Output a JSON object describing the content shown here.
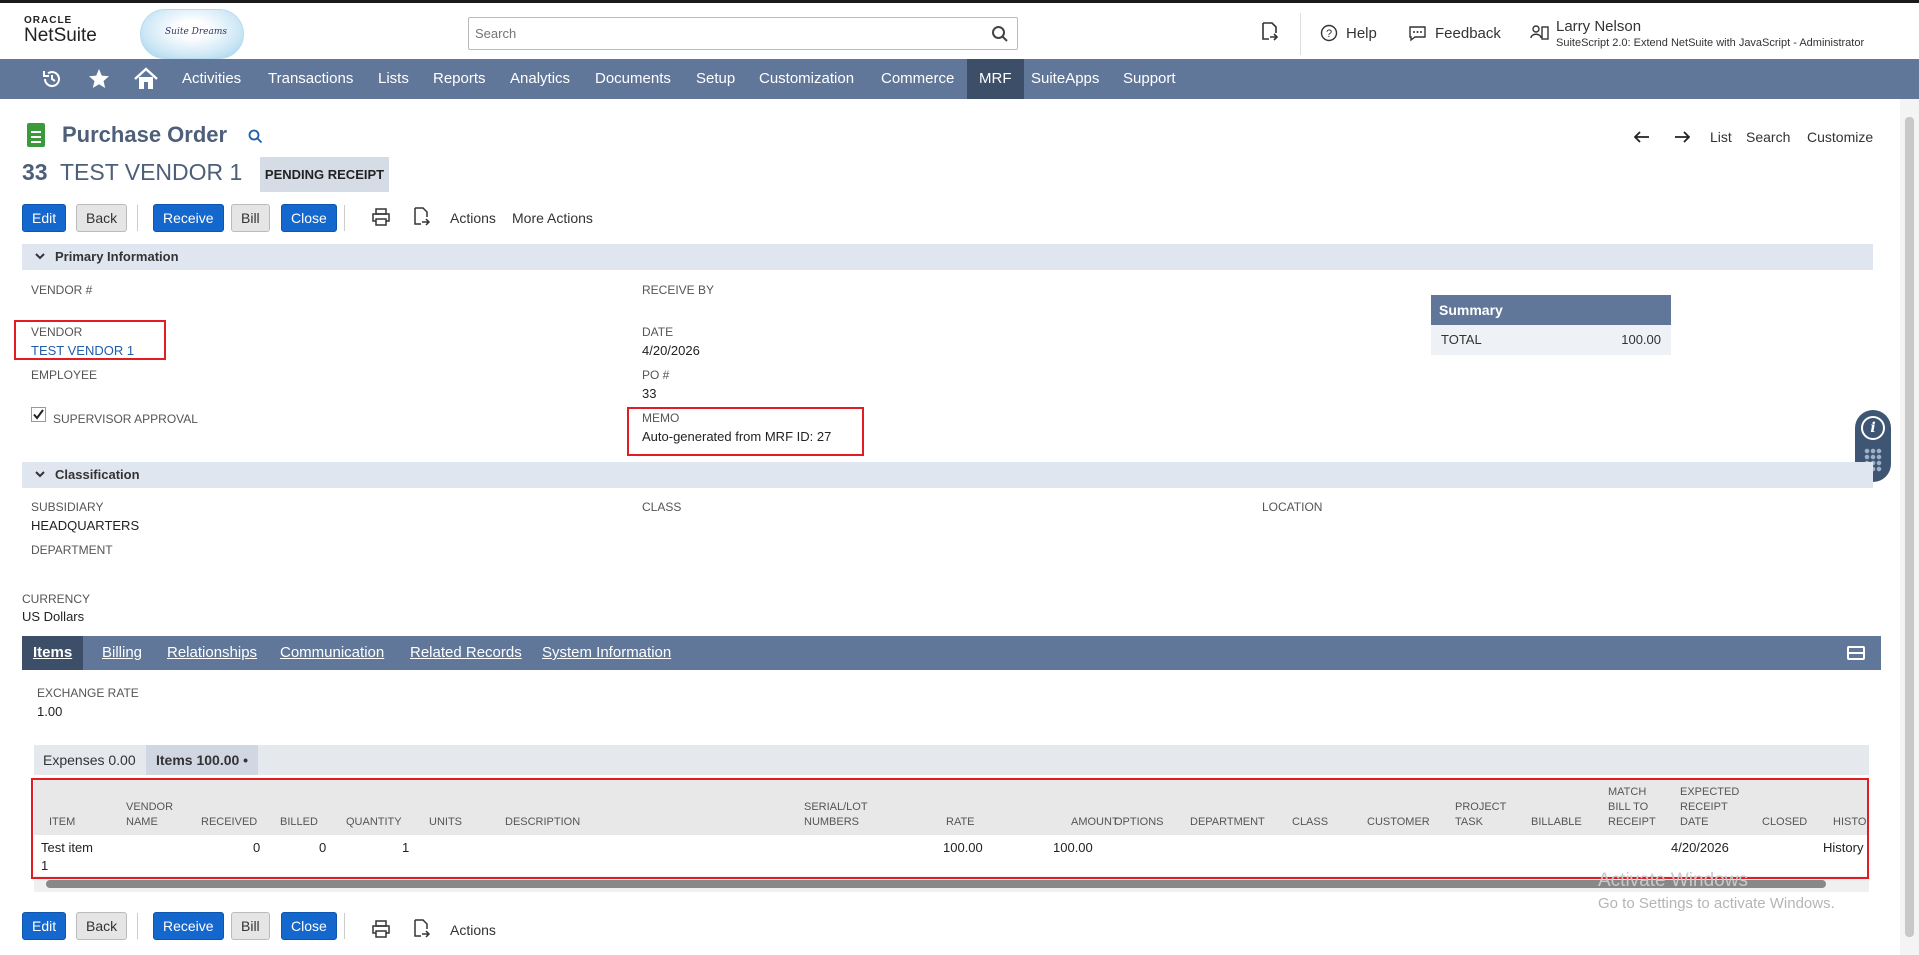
{
  "header": {
    "brand_top": "ORACLE",
    "brand_main": "NetSuite",
    "cloud_logo_text": "Suite Dreams",
    "search_placeholder": "Search",
    "help": "Help",
    "feedback": "Feedback",
    "user_name": "Larry Nelson",
    "user_role": "SuiteScript 2.0: Extend NetSuite with JavaScript - Administrator"
  },
  "nav": {
    "items": [
      "Activities",
      "Transactions",
      "Lists",
      "Reports",
      "Analytics",
      "Documents",
      "Setup",
      "Customization",
      "Commerce",
      "MRF",
      "SuiteApps",
      "Support"
    ],
    "active": "MRF"
  },
  "record": {
    "type": "Purchase Order",
    "number": "33",
    "vendor_title": "TEST VENDOR 1",
    "status": "PENDING RECEIPT",
    "top_nav": {
      "list": "List",
      "search": "Search",
      "customize": "Customize"
    }
  },
  "actions": {
    "edit": "Edit",
    "back": "Back",
    "receive": "Receive",
    "bill": "Bill",
    "close": "Close",
    "actions": "Actions",
    "more_actions": "More Actions"
  },
  "primary": {
    "section_label": "Primary Information",
    "vendor_num_label": "VENDOR #",
    "vendor_label": "VENDOR",
    "vendor_value": "TEST VENDOR 1",
    "employee_label": "EMPLOYEE",
    "supervisor_label": "SUPERVISOR APPROVAL",
    "supervisor_checked": true,
    "receive_by_label": "RECEIVE BY",
    "date_label": "DATE",
    "date_value": "4/20/2026",
    "po_label": "PO #",
    "po_value": "33",
    "memo_label": "MEMO",
    "memo_value": "Auto-generated from MRF ID: 27"
  },
  "summary": {
    "title": "Summary",
    "total_label": "TOTAL",
    "total_value": "100.00"
  },
  "classification": {
    "section_label": "Classification",
    "subsidiary_label": "SUBSIDIARY",
    "subsidiary_value": "HEADQUARTERS",
    "department_label": "DEPARTMENT",
    "class_label": "CLASS",
    "location_label": "LOCATION",
    "currency_label": "CURRENCY",
    "currency_value": "US Dollars"
  },
  "subtabs": {
    "items": [
      "Items",
      "Billing",
      "Relationships",
      "Communication",
      "Related Records",
      "System Information"
    ],
    "active": "Items"
  },
  "items_tab": {
    "exchange_rate_label": "EXCHANGE RATE",
    "exchange_rate_value": "1.00",
    "sublist_tabs": [
      "Expenses 0.00",
      "Items 100.00 •"
    ],
    "columns": {
      "item": "ITEM",
      "vendor_name_1": "VENDOR",
      "vendor_name_2": "NAME",
      "received": "RECEIVED",
      "billed": "BILLED",
      "quantity": "QUANTITY",
      "units": "UNITS",
      "description": "DESCRIPTION",
      "serial_1": "SERIAL/LOT",
      "serial_2": "NUMBERS",
      "rate": "RATE",
      "amount": "AMOUNT",
      "options": "OPTIONS",
      "department": "DEPARTMENT",
      "class": "CLASS",
      "customer": "CUSTOMER",
      "project_1": "PROJECT",
      "project_2": "TASK",
      "billable": "BILLABLE",
      "match_1": "MATCH",
      "match_2": "BILL TO",
      "match_3": "RECEIPT",
      "erd_1": "EXPECTED",
      "erd_2": "RECEIPT",
      "erd_3": "DATE",
      "closed": "CLOSED",
      "history": "HISTO"
    },
    "row": {
      "item_1": "Test item",
      "item_2": "1",
      "received": "0",
      "billed": "0",
      "quantity": "1",
      "rate": "100.00",
      "amount": "100.00",
      "expected_receipt_date": "4/20/2026",
      "history": "History"
    }
  },
  "watermark": {
    "line1": "Activate Windows",
    "line2": "Go to Settings to activate Windows."
  },
  "colors": {
    "nav_bg": "#607799",
    "nav_active": "#3d4e68",
    "primary_button": "#1467cc",
    "highlight_box": "#e31b23"
  }
}
